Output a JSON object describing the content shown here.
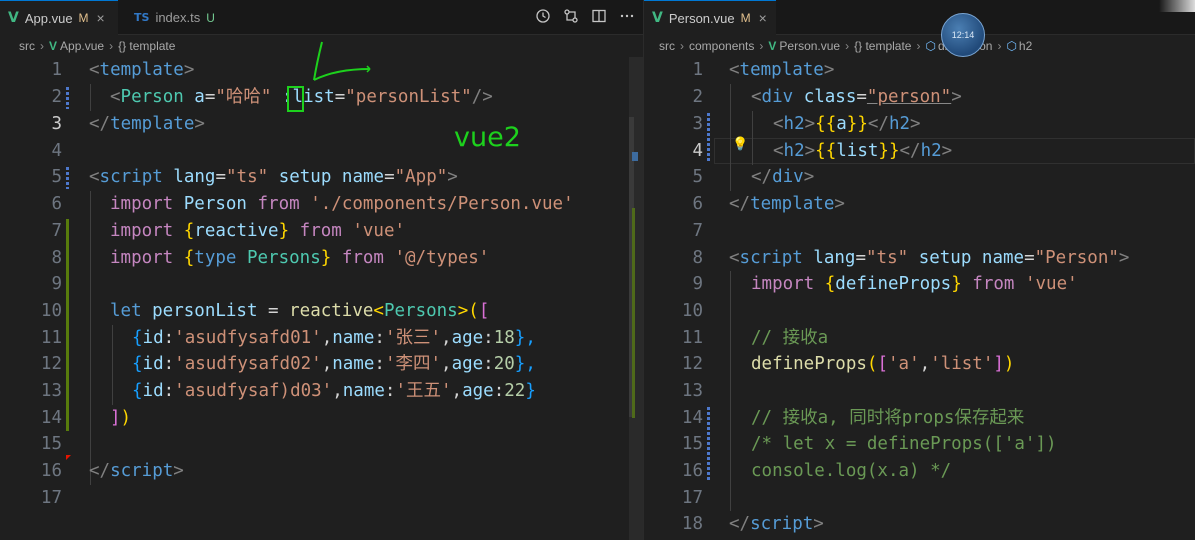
{
  "left": {
    "tabs": [
      {
        "icon": "vue-icon",
        "name": "App.vue",
        "status": "M",
        "close": "×"
      },
      {
        "icon": "ts-icon",
        "icon_text": "TS",
        "name": "index.ts",
        "status": "U"
      }
    ],
    "breadcrumb": {
      "p1": "src",
      "p2": "App.vue",
      "p3": "{} template"
    },
    "annotation": "vue2",
    "lines": [
      "1",
      "2",
      "3",
      "4",
      "5",
      "6",
      "7",
      "8",
      "9",
      "10",
      "11",
      "12",
      "13",
      "14",
      "15",
      "16",
      "17"
    ],
    "code": {
      "l1a": "<",
      "l1b": "template",
      "l1c": ">",
      "l2a": "<",
      "l2b": "Person",
      "l2c": " a",
      "l2d": "=",
      "l2e": "\"哈哈\"",
      "l2f": " :",
      "l2g": "list",
      "l2h": "=",
      "l2i": "\"personList\"",
      "l2j": "/>",
      "l3a": "</",
      "l3b": "template",
      "l3c": ">",
      "l5a": "<",
      "l5b": "script",
      "l5c": " lang",
      "l5d": "=",
      "l5e": "\"ts\"",
      "l5f": " setup",
      "l5g": " name",
      "l5h": "=",
      "l5i": "\"App\"",
      "l5j": ">",
      "l6a": "import",
      "l6b": " Person ",
      "l6c": "from",
      "l6d": " './components/Person.vue'",
      "l7a": "import",
      "l7b": " {",
      "l7c": "reactive",
      "l7d": "} ",
      "l7e": "from",
      "l7f": " 'vue'",
      "l8a": "import",
      "l8b": " {",
      "l8c": "type",
      "l8d": " Persons",
      "l8e": "} ",
      "l8f": "from",
      "l8g": " '@/types'",
      "l10a": "let",
      "l10b": " personList",
      "l10c": " = ",
      "l10d": "reactive",
      "l10e": "<",
      "l10f": "Persons",
      "l10g": ">",
      "l10h": "(",
      "l10i": "[",
      "l11a": "{",
      "l11b": "id",
      "l11c": ":",
      "l11d": "'asudfysafd01'",
      "l11e": ",",
      "l11f": "name",
      "l11g": ":",
      "l11h": "'张三'",
      "l11i": ",",
      "l11j": "age",
      "l11k": ":",
      "l11l": "18",
      "l11m": "},",
      "l12a": "{",
      "l12b": "id",
      "l12c": ":",
      "l12d": "'asudfysafd02'",
      "l12e": ",",
      "l12f": "name",
      "l12g": ":",
      "l12h": "'李四'",
      "l12i": ",",
      "l12j": "age",
      "l12k": ":",
      "l12l": "20",
      "l12m": "},",
      "l13a": "{",
      "l13b": "id",
      "l13c": ":",
      "l13d": "'asudfysaf)d03'",
      "l13e": ",",
      "l13f": "name",
      "l13g": ":",
      "l13h": "'王五'",
      "l13i": ",",
      "l13j": "age",
      "l13k": ":",
      "l13l": "22",
      "l13m": "}",
      "l14a": "]",
      "l14b": ")",
      "l16a": "</",
      "l16b": "script",
      "l16c": ">"
    }
  },
  "right": {
    "tabs": [
      {
        "icon": "vue-icon",
        "name": "Person.vue",
        "status": "M",
        "close": "×"
      }
    ],
    "clock": "12:14",
    "breadcrumb": {
      "p1": "src",
      "p2": "components",
      "p3": "Person.vue",
      "p4": "{} template",
      "p5": "div.person",
      "p6": "h2"
    },
    "lines": [
      "1",
      "2",
      "3",
      "4",
      "5",
      "6",
      "7",
      "8",
      "9",
      "10",
      "11",
      "12",
      "13",
      "14",
      "15",
      "16",
      "17",
      "18"
    ],
    "code": {
      "l1a": "<",
      "l1b": "template",
      "l1c": ">",
      "l2a": "<",
      "l2b": "div",
      "l2c": " class",
      "l2d": "=",
      "l2e": "\"person\"",
      "l2f": ">",
      "l3a": "<",
      "l3b": "h2",
      "l3c": ">",
      "l3d": "{{",
      "l3e": "a",
      "l3f": "}}",
      "l3g": "</",
      "l3h": "h2",
      "l3i": ">",
      "l4a": "<",
      "l4b": "h2",
      "l4c": ">",
      "l4d": "{{",
      "l4e": "list",
      "l4f": "}}",
      "l4g": "</",
      "l4h": "h2",
      "l4i": ">",
      "l5a": "</",
      "l5b": "div",
      "l5c": ">",
      "l6a": "</",
      "l6b": "template",
      "l6c": ">",
      "l8a": "<",
      "l8b": "script",
      "l8c": " lang",
      "l8d": "=",
      "l8e": "\"ts\"",
      "l8f": " setup",
      "l8g": " name",
      "l8h": "=",
      "l8i": "\"Person\"",
      "l8j": ">",
      "l9a": "import",
      "l9b": " {",
      "l9c": "defineProps",
      "l9d": "} ",
      "l9e": "from",
      "l9f": " 'vue'",
      "l11a": "// 接收a",
      "l12a": "defineProps",
      "l12b": "(",
      "l12c": "[",
      "l12d": "'a'",
      "l12e": ",",
      "l12f": "'list'",
      "l12g": "]",
      "l12h": ")",
      "l14a": "// 接收a, 同时将props保存起来",
      "l15a": "/* let x = defineProps(['a'])",
      "l16a": "console.log(x.a) */",
      "l18a": "</",
      "l18b": "script",
      "l18c": ">"
    }
  }
}
